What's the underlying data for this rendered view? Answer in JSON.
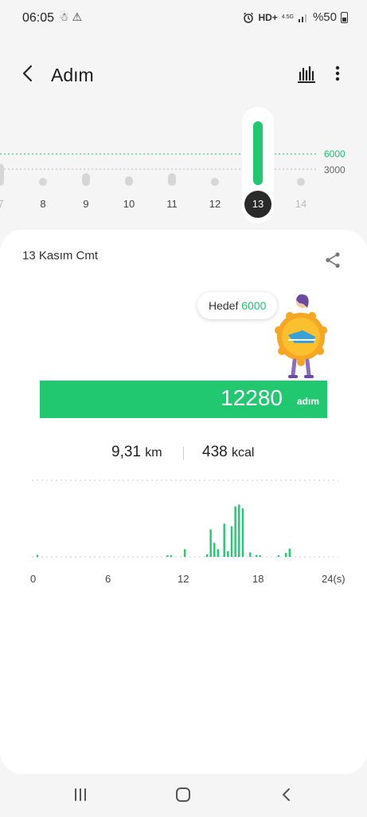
{
  "status": {
    "time": "06:05",
    "icons": "☃ ⚠",
    "network": "HD+",
    "network_sub": "4.5G",
    "battery": "%50"
  },
  "header": {
    "title": "Adım",
    "back_icon": "chevron-left-icon",
    "chart_icon": "bar-chart-icon",
    "more_icon": "more-vertical-icon"
  },
  "strip": {
    "goal_value": "6000",
    "ref_value": "3000",
    "days": [
      "7",
      "8",
      "9",
      "10",
      "11",
      "12",
      "13",
      "14"
    ],
    "selected_day": "13",
    "selected_progress": 1.0
  },
  "card": {
    "date": "13 Kasım Cmt",
    "share_icon": "share-icon",
    "goal_label": "Hedef",
    "goal_value": "6000",
    "steps": "12280",
    "steps_unit": "adım",
    "distance": "9,31",
    "distance_unit": "km",
    "calories": "438",
    "calories_unit": "kcal"
  },
  "chart_data": {
    "type": "bar",
    "x_ticks": [
      "0",
      "6",
      "12",
      "18",
      "24(s)"
    ],
    "xlim": [
      0,
      24
    ],
    "note_bars_hours_relative": true,
    "bars": [
      {
        "h": 0.25,
        "v": 0.03
      },
      {
        "h": 10.8,
        "v": 0.02
      },
      {
        "h": 11.1,
        "v": 0.02
      },
      {
        "h": 12.2,
        "v": 0.12
      },
      {
        "h": 14.0,
        "v": 0.04
      },
      {
        "h": 14.3,
        "v": 0.43
      },
      {
        "h": 14.6,
        "v": 0.22
      },
      {
        "h": 14.9,
        "v": 0.12
      },
      {
        "h": 15.4,
        "v": 0.52
      },
      {
        "h": 15.7,
        "v": 0.09
      },
      {
        "h": 16.0,
        "v": 0.48
      },
      {
        "h": 16.3,
        "v": 0.79
      },
      {
        "h": 16.6,
        "v": 0.82
      },
      {
        "h": 16.9,
        "v": 0.76
      },
      {
        "h": 17.5,
        "v": 0.07
      },
      {
        "h": 18.0,
        "v": 0.03
      },
      {
        "h": 18.3,
        "v": 0.02
      },
      {
        "h": 19.8,
        "v": 0.02
      },
      {
        "h": 20.4,
        "v": 0.06
      },
      {
        "h": 20.7,
        "v": 0.13
      }
    ]
  },
  "nav": {
    "recent_icon": "recent-apps-icon",
    "home_icon": "home-icon",
    "back_icon": "back-icon"
  },
  "colors": {
    "accent": "#22c870",
    "dark": "#2a2a2a"
  }
}
